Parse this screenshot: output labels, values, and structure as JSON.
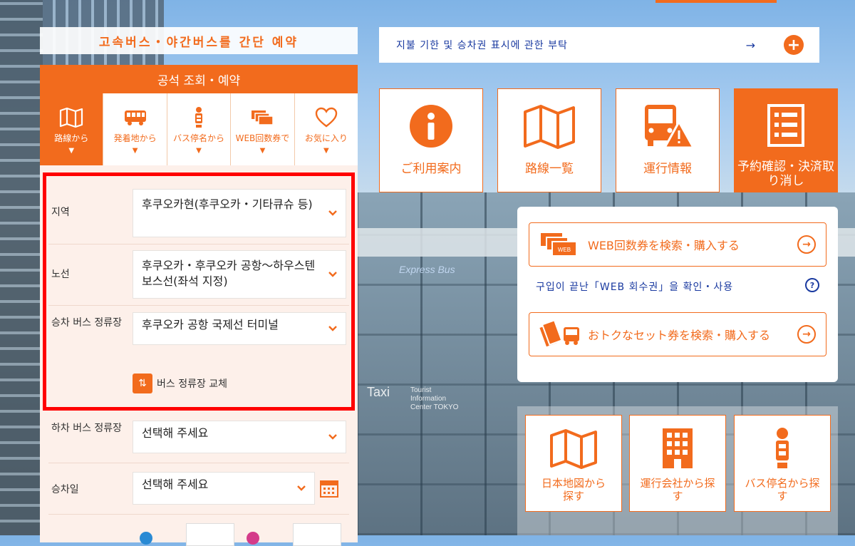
{
  "banner": {
    "title": "고속버스・야간버스를 간단 예약"
  },
  "notice": {
    "text": "지불 기한 및 승차권 표시에 관한 부탁",
    "arrow": "→",
    "plus": "+"
  },
  "panel": {
    "title": "공석 조회・예약",
    "tabs": [
      {
        "label": "路線から",
        "icon": "map-icon"
      },
      {
        "label": "発着地から",
        "icon": "bus-icon"
      },
      {
        "label": "バス停名から",
        "icon": "bus-stop-icon"
      },
      {
        "label": "WEB回数券で",
        "icon": "tickets-icon"
      },
      {
        "label": "お気に入り",
        "icon": "heart-icon"
      }
    ],
    "caret": "▼",
    "fields": {
      "region": {
        "label": "지역",
        "value": "후쿠오카현(후쿠오카・기타큐슈 등)"
      },
      "route": {
        "label": "노선",
        "value": "후쿠오카・후쿠오카 공항～하우스텐보스선(좌석 지정)"
      },
      "boarding": {
        "label": "승차 버스 정류장",
        "value": "후쿠오카 공항 국제선 터미널"
      },
      "swap": {
        "label": "버스 정류장 교체",
        "icon": "⇅"
      },
      "alighting": {
        "label": "하차 버스 정류장",
        "value": "선택해 주세요"
      },
      "date": {
        "label": "승차일",
        "value": "선택해 주세요"
      }
    }
  },
  "tiles": [
    {
      "label": "ご利用案内",
      "icon": "info-icon"
    },
    {
      "label": "路線一覧",
      "icon": "map-icon"
    },
    {
      "label": "運行情報",
      "icon": "bus-warning-icon"
    },
    {
      "label": "予約確認・決済取り消し",
      "icon": "list-icon"
    }
  ],
  "card": {
    "web_ticket_button": "WEB回数券を検索・購入する",
    "web_ticket_link": "구입이 끝난「WEB 회수권」을 확인・사용",
    "set_ticket_button": "おトクなセット券を検索・購入する",
    "help": "?",
    "go": "→"
  },
  "bottom_tiles": [
    {
      "label": "日本地図から探す",
      "icon": "map-icon"
    },
    {
      "label": "運行会社から探す",
      "icon": "building-icon"
    },
    {
      "label": "バス停名から探す",
      "icon": "bus-stop-icon"
    }
  ],
  "background": {
    "sign_taxi": "Taxi",
    "sign_tourist": "Tourist Information Center TOKYO",
    "sign_bus": "Express Bus"
  },
  "colors": {
    "accent": "#f26b1d",
    "link": "#1a3aa0",
    "highlight": "#ff0000"
  }
}
